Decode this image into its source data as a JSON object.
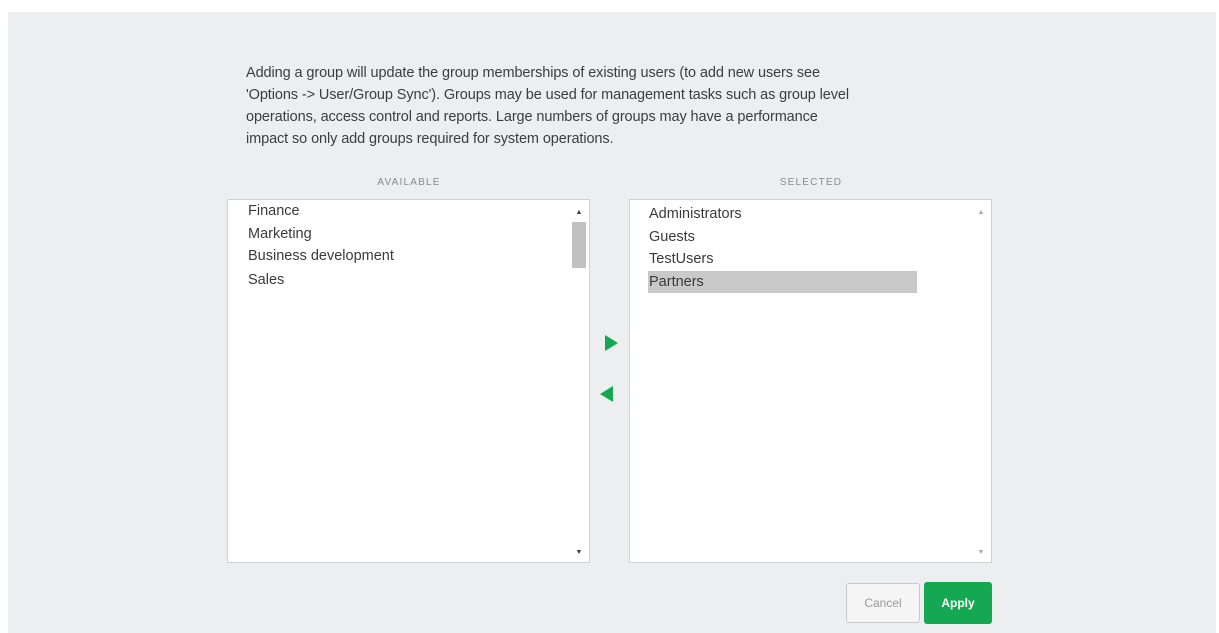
{
  "description": {
    "lines": [
      "Adding a group will update the group memberships of existing users (to add new users see",
      "'Options -> User/Group Sync').  Groups may be used for management tasks such as group level",
      "operations, access control and reports.  Large numbers of groups may have a performance",
      "impact so only add groups required for system operations."
    ]
  },
  "available": {
    "header": "AVAILABLE",
    "items": [
      "Finance",
      "Marketing",
      "Business development",
      "Sales"
    ]
  },
  "selected": {
    "header": "SELECTED",
    "items": [
      "Administrators",
      "Guests",
      "TestUsers",
      "Partners"
    ],
    "highlighted_item": "Partners"
  },
  "transfer": {
    "add_icon": "triangle-right-icon",
    "remove_icon": "triangle-left-icon",
    "accent_color": "#14a853"
  },
  "buttons": {
    "cancel_label": "Cancel",
    "apply_label": "Apply",
    "apply_color": "#14a853"
  }
}
